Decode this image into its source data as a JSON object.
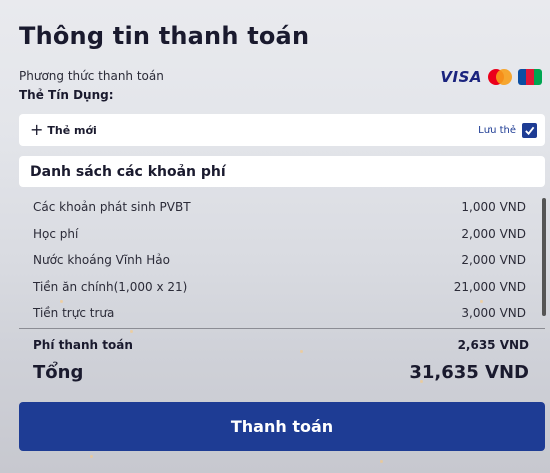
{
  "title": "Thông tin thanh toán",
  "payment_method": {
    "label": "Phương thức thanh toán",
    "value": "Thẻ Tín Dụng:",
    "card_brands": [
      "visa-logo",
      "mastercard-logo",
      "jcb-logo"
    ],
    "visa_text": "VISA"
  },
  "new_card": {
    "label": "Thẻ mới",
    "save_label": "Lưu thẻ",
    "save_checked": true
  },
  "fees": {
    "heading": "Danh sách các khoản phí",
    "items": [
      {
        "name": "Các khoản phát sinh PVBT",
        "amount": "1,000 VND"
      },
      {
        "name": "Học phí",
        "amount": "2,000 VND"
      },
      {
        "name": "Nước khoáng Vĩnh Hảo",
        "amount": "2,000 VND"
      },
      {
        "name": "Tiền ăn chính(1,000 x 21)",
        "amount": "21,000 VND"
      },
      {
        "name": "Tiền trực trưa",
        "amount": "3,000 VND"
      }
    ]
  },
  "payment_fee": {
    "label": "Phí thanh toán",
    "amount": "2,635 VND"
  },
  "total": {
    "label": "Tổng",
    "amount": "31,635 VND"
  },
  "pay_button": "Thanh toán",
  "colors": {
    "primary": "#1e3c94",
    "text": "#1a1a2e"
  }
}
